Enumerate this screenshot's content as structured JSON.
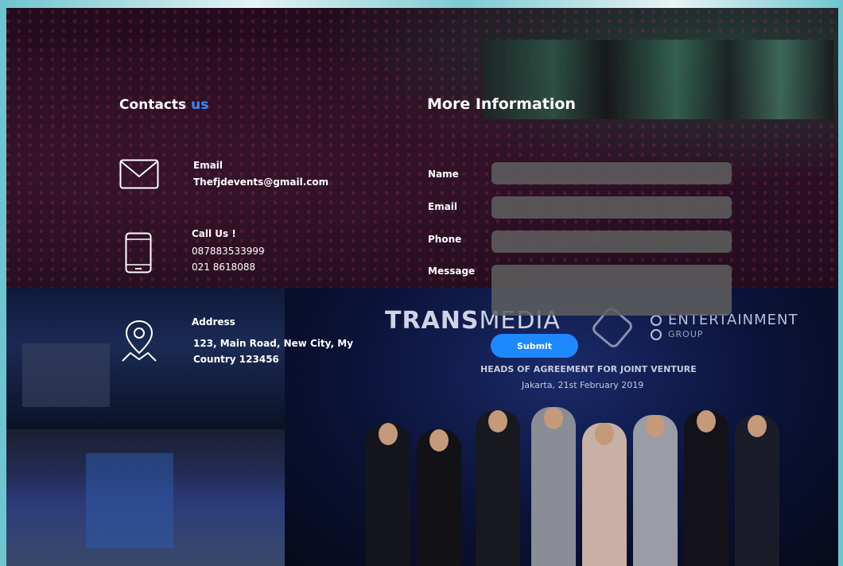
{
  "contacts": {
    "heading": "Contacts",
    "heading_accent": "us",
    "email": {
      "label": "Email",
      "value": "Thefjdevents@gmail.com"
    },
    "phone": {
      "label": "Call Us !",
      "line1": "087883533999",
      "line2": "021 8618088"
    },
    "address": {
      "label": "Address",
      "line1": "123, Main Road, New City, My",
      "line2": "Country 123456"
    }
  },
  "form": {
    "heading": "More Information",
    "name_label": "Name",
    "email_label": "Email",
    "phone_label": "Phone",
    "message_label": "Message",
    "name_value": "",
    "email_value": "",
    "phone_value": "",
    "message_value": "",
    "submit_label": "Submit"
  },
  "background_photo": {
    "banner_trans": "TRANS",
    "banner_media": "MEDIA",
    "banner_entertainment": "ENTERTAINMENT",
    "banner_group": "GROUP",
    "headline": "HEADS OF AGREEMENT FOR JOINT VENTURE",
    "dateline": "Jakarta, 21st February 2019"
  },
  "colors": {
    "accent": "#3b8cff",
    "submit": "#1e88ff",
    "field_bg": "#5f5f5f",
    "frame": "#6ec5cf"
  }
}
